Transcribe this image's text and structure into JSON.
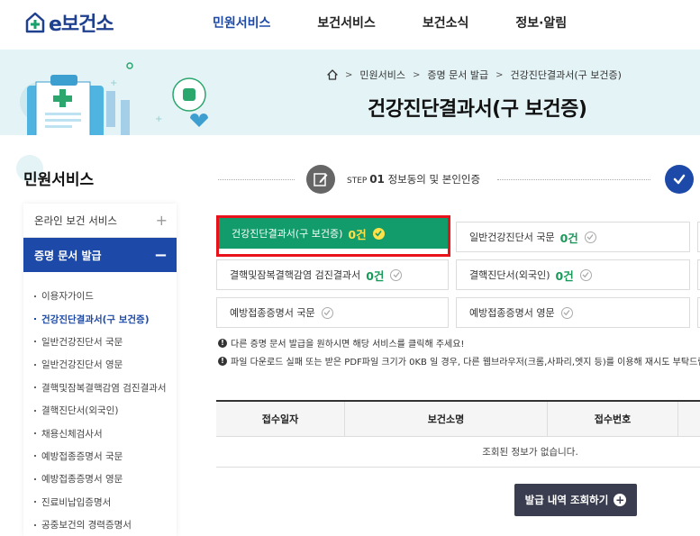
{
  "header": {
    "logo_text": "e보건소",
    "nav": [
      {
        "label": "민원서비스",
        "active": true
      },
      {
        "label": "보건서비스",
        "active": false
      },
      {
        "label": "보건소식",
        "active": false
      },
      {
        "label": "정보·알림",
        "active": false
      }
    ]
  },
  "banner": {
    "breadcrumb": [
      "민원서비스",
      "증명 문서 발급",
      "건강진단결과서(구 보건증)"
    ],
    "title": "건강진단결과서(구 보건증)"
  },
  "sidebar": {
    "title": "민원서비스",
    "group1": "온라인 보건 서비스",
    "group2": "증명 문서 발급",
    "items": [
      "이용자가이드",
      "건강진단결과서(구 보건증)",
      "일반건강진단서 국문",
      "일반건강진단서 영문",
      "결핵및잠복결핵감염 검진결과서",
      "결핵진단서(외국인)",
      "채용신체검사서",
      "예방접종증명서 국문",
      "예방접종증명서 영문",
      "진료비납입증명서",
      "공중보건의 경력증명서"
    ],
    "active_index": 1
  },
  "step": {
    "prefix": "STEP",
    "number": "01",
    "label": "정보동의 및 본인인증"
  },
  "certs": [
    {
      "label": "건강진단결과서(구 보건증)",
      "count": "0건",
      "selected": true
    },
    {
      "label": "일반건강진단서 국문",
      "count": "0건",
      "selected": false
    },
    {
      "label": "결핵및잠복결핵감염 검진결과서",
      "count": "0건",
      "selected": false
    },
    {
      "label": "결핵진단서(외국인)",
      "count": "0건",
      "selected": false
    },
    {
      "label": "예방접종증명서 국문",
      "count": "",
      "selected": false
    },
    {
      "label": "예방접종증명서 영문",
      "count": "",
      "selected": false
    }
  ],
  "notices": [
    "다른 증명 문서 발급을 원하시면 해당 서비스를 클릭해 주세요!",
    "파일 다운로드 실패 또는 받은 PDF파일 크기가 0KB 일 경우, 다른 웹브라우저(크롬,사파리,엣지 등)를 이용해 재시도 부탁드립니"
  ],
  "table": {
    "headers": [
      "접수일자",
      "보건소명",
      "접수번호"
    ],
    "empty_text": "조회된 정보가 없습니다."
  },
  "history_button": "발급 내역 조회하기",
  "colors": {
    "primary": "#1d4aa8",
    "selected_card": "#129c6b",
    "highlight": "#e8131a",
    "banner_bg": "#e4f3f5"
  }
}
